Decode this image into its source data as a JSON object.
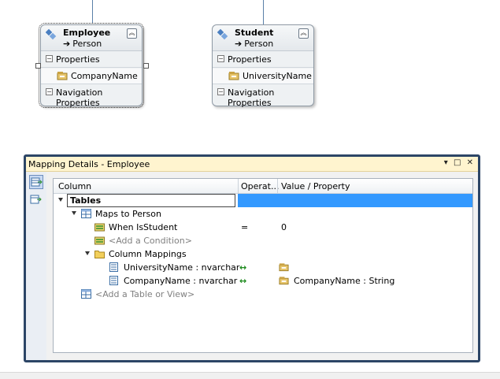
{
  "entities": [
    {
      "name": "Employee",
      "base": "Person",
      "section_properties": "Properties",
      "property": "CompanyName",
      "section_navigation": "Navigation Properties"
    },
    {
      "name": "Student",
      "base": "Person",
      "section_properties": "Properties",
      "property": "UniversityName",
      "section_navigation": "Navigation Properties"
    }
  ],
  "mapping": {
    "title": "Mapping Details - Employee",
    "window_buttons": [
      "▾",
      "□",
      "✕"
    ],
    "columns": [
      "Column",
      "Operat...",
      "Value / Property"
    ],
    "rows": {
      "tables": "Tables",
      "maps_to": "Maps to Person",
      "condition_column": "When IsStudent",
      "condition_op": "=",
      "condition_value": "0",
      "add_condition": "<Add a Condition>",
      "column_mappings": "Column Mappings",
      "mapping1_column": "UniversityName : nvarchar",
      "mapping1_op": "↔",
      "mapping1_value": "",
      "mapping2_column": "CompanyName : nvarchar",
      "mapping2_op": "↔",
      "mapping2_value": "CompanyName : String",
      "add_table": "<Add a Table or View>"
    }
  },
  "colors": {
    "accent": "#3399ff",
    "window_border": "#2c4566",
    "title_bar": "#fff4cf"
  }
}
